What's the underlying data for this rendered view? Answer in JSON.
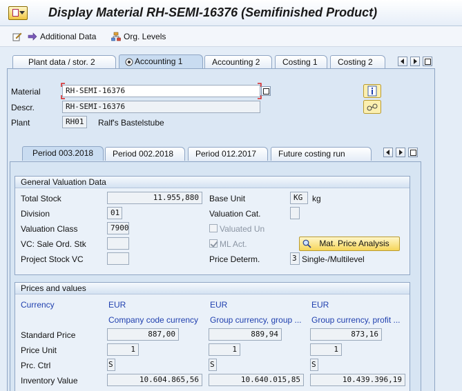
{
  "window": {
    "title": "Display Material RH-SEMI-16376 (Semifinished Product)"
  },
  "toolbar": {
    "additional_data": "Additional Data",
    "org_levels": "Org. Levels"
  },
  "tabs": [
    "Plant data / stor. 2",
    "Accounting 1",
    "Accounting 2",
    "Costing 1",
    "Costing 2"
  ],
  "header_fields": {
    "material_label": "Material",
    "material_value": "RH-SEMI-16376",
    "descr_label": "Descr.",
    "descr_value": "RH-SEMI-16376",
    "plant_label": "Plant",
    "plant_value": "RH01",
    "plant_name": "Ralf's Bastelstube"
  },
  "period_tabs": [
    "Period 003.2018",
    "Period 002.2018",
    "Period 012.2017",
    "Future costing run"
  ],
  "general_valuation": {
    "header": "General Valuation Data",
    "total_stock_label": "Total Stock",
    "total_stock_value": "11.955,880",
    "base_unit_label": "Base Unit",
    "base_unit_value": "KG",
    "base_unit_text": "kg",
    "division_label": "Division",
    "division_value": "01",
    "valuation_cat_label": "Valuation Cat.",
    "valuation_cat_value": "",
    "valuation_class_label": "Valuation Class",
    "valuation_class_value": "7900",
    "valuated_un_label": "Valuated Un",
    "vc_sale_label": "VC: Sale Ord. Stk",
    "vc_sale_value": "",
    "ml_act_label": "ML Act.",
    "mat_price_analysis": "Mat. Price Analysis",
    "project_stock_label": "Project Stock VC",
    "project_stock_value": "",
    "price_determ_label": "Price Determ.",
    "price_determ_value": "3",
    "price_determ_text": "Single-/Multilevel"
  },
  "prices": {
    "header": "Prices and values",
    "currency_label": "Currency",
    "currencies": [
      "EUR",
      "EUR",
      "EUR"
    ],
    "currency_types": [
      "Company code currency",
      "Group currency, group ...",
      "Group currency, profit ..."
    ],
    "standard_price_label": "Standard Price",
    "standard_prices": [
      "887,00",
      "889,94",
      "873,16"
    ],
    "price_unit_label": "Price Unit",
    "price_units": [
      "1",
      "1",
      "1"
    ],
    "prc_ctrl_label": "Prc. Ctrl",
    "prc_ctrls": [
      "S",
      "S",
      "S"
    ],
    "inventory_value_label": "Inventory Value",
    "inventory_values": [
      "10.604.865,56",
      "10.640.015,85",
      "10.439.396,19"
    ]
  },
  "colors": {
    "accent_blue": "#1f3fae",
    "button_yellow": "#f6d65a",
    "panel_bg": "#dbe7f4"
  }
}
